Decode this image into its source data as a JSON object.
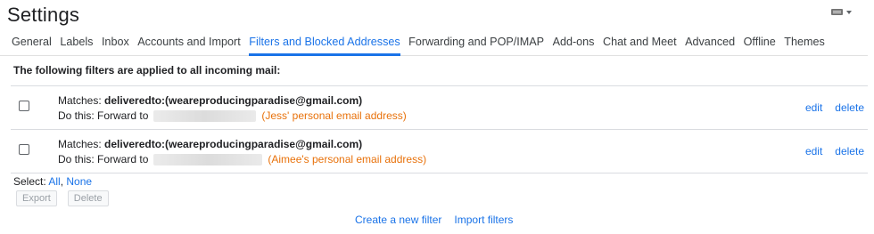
{
  "header": {
    "title": "Settings"
  },
  "tabs": [
    {
      "label": "General",
      "active": false
    },
    {
      "label": "Labels",
      "active": false
    },
    {
      "label": "Inbox",
      "active": false
    },
    {
      "label": "Accounts and Import",
      "active": false
    },
    {
      "label": "Filters and Blocked Addresses",
      "active": true
    },
    {
      "label": "Forwarding and POP/IMAP",
      "active": false
    },
    {
      "label": "Add-ons",
      "active": false
    },
    {
      "label": "Chat and Meet",
      "active": false
    },
    {
      "label": "Advanced",
      "active": false
    },
    {
      "label": "Offline",
      "active": false
    },
    {
      "label": "Themes",
      "active": false
    }
  ],
  "intro": "The following filters are applied to all incoming mail:",
  "filters": [
    {
      "matches_label": "Matches: ",
      "matches_value": "deliveredto:(weareproducingparadise@gmail.com)",
      "action_label": "Do this: Forward to",
      "note": "(Jess' personal email address)",
      "edit_label": "edit",
      "delete_label": "delete"
    },
    {
      "matches_label": "Matches: ",
      "matches_value": "deliveredto:(weareproducingparadise@gmail.com)",
      "action_label": "Do this: Forward to",
      "note": "(Aimee's personal email address)",
      "edit_label": "edit",
      "delete_label": "delete"
    }
  ],
  "select": {
    "label": "Select: ",
    "all": "All",
    "separator": ", ",
    "none": "None"
  },
  "buttons": {
    "export": "Export",
    "delete": "Delete"
  },
  "bottom_links": {
    "create": "Create a new filter",
    "import": "Import filters"
  },
  "colors": {
    "accent": "#1a73e8",
    "note": "#e8710a",
    "text": "#202124",
    "divider": "#dadce0"
  },
  "icons": {
    "keyboard": "keyboard-icon",
    "dropdown": "chevron-down-icon"
  }
}
